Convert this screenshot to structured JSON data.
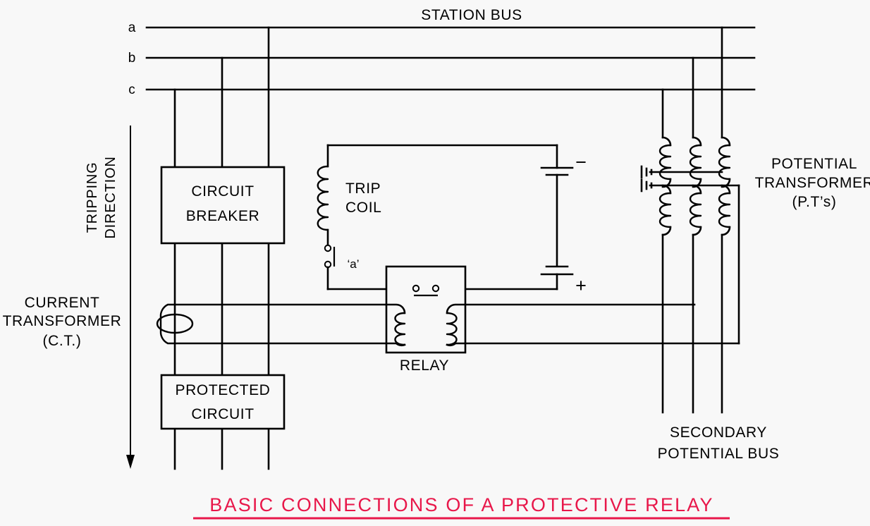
{
  "title": {
    "text": "BASIC  CONNECTIONS  OF  A  PROTECTIVE  RELAY",
    "color": "#e8174a",
    "underline": true
  },
  "colors": {
    "background": "#f8f8f8",
    "line": "#000000",
    "text": "#000000",
    "title_accent": "#e8174a"
  },
  "labels": {
    "station_bus": "STATION  BUS",
    "phase_a": "a",
    "phase_b": "b",
    "phase_c": "c",
    "tripping_direction_line1": "TRIPPING",
    "tripping_direction_line2": "DIRECTION",
    "circuit_breaker_line1": "CIRCUIT",
    "circuit_breaker_line2": "BREAKER",
    "protected_circuit_line1": "PROTECTED",
    "protected_circuit_line2": "CIRCUIT",
    "current_transformer_line1": "CURRENT",
    "current_transformer_line2": "TRANSFORMER",
    "current_transformer_line3": "(C.T.)",
    "trip_coil_line1": "TRIP",
    "trip_coil_line2": "COIL",
    "aux_contact": "‘a’",
    "relay": "RELAY",
    "battery_negative": "−",
    "battery_positive": "+",
    "potential_transformer_line1": "POTENTIAL",
    "potential_transformer_line2": "TRANSFORMER",
    "potential_transformer_line3": "(P.T’s)",
    "secondary_bus_line1": "SECONDARY",
    "secondary_bus_line2": "POTENTIAL  BUS"
  },
  "components": [
    {
      "name": "station-bus",
      "type": "bus",
      "phases": 3
    },
    {
      "name": "circuit-breaker",
      "type": "block"
    },
    {
      "name": "protected-circuit",
      "type": "block"
    },
    {
      "name": "current-transformer",
      "type": "ct",
      "phase": "c"
    },
    {
      "name": "trip-coil",
      "type": "coil"
    },
    {
      "name": "auxiliary-contact-a",
      "type": "contact"
    },
    {
      "name": "relay",
      "type": "relay",
      "coils": 2,
      "contacts": 1
    },
    {
      "name": "battery",
      "type": "dc-source"
    },
    {
      "name": "potential-transformer",
      "type": "pt",
      "phases": 3,
      "windings": 2
    },
    {
      "name": "secondary-potential-bus",
      "type": "bus",
      "phases": 3
    }
  ]
}
